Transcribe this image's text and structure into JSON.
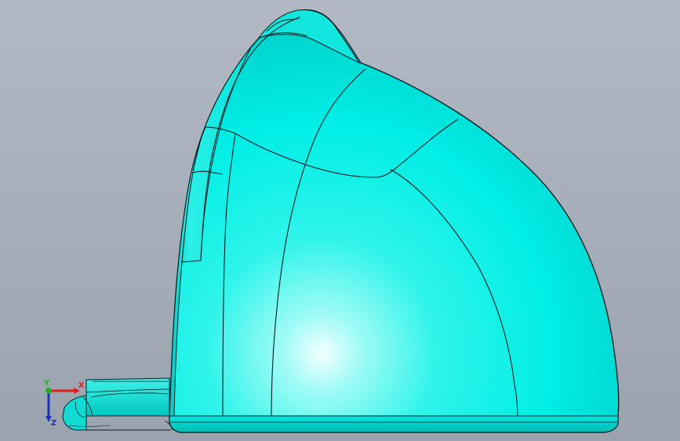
{
  "viewport": {
    "background_top": "#b2b9c4",
    "background_bottom": "#9aa3ae"
  },
  "model": {
    "part_color": "#00f0e8",
    "highlight_color": "#e8ffff",
    "edge_color": "#0b1e22"
  },
  "triad": {
    "x_label": "X",
    "y_label": "Y",
    "z_label": "Z",
    "x_color": "#e02020",
    "y_color": "#20b020",
    "z_color": "#2030c0"
  }
}
